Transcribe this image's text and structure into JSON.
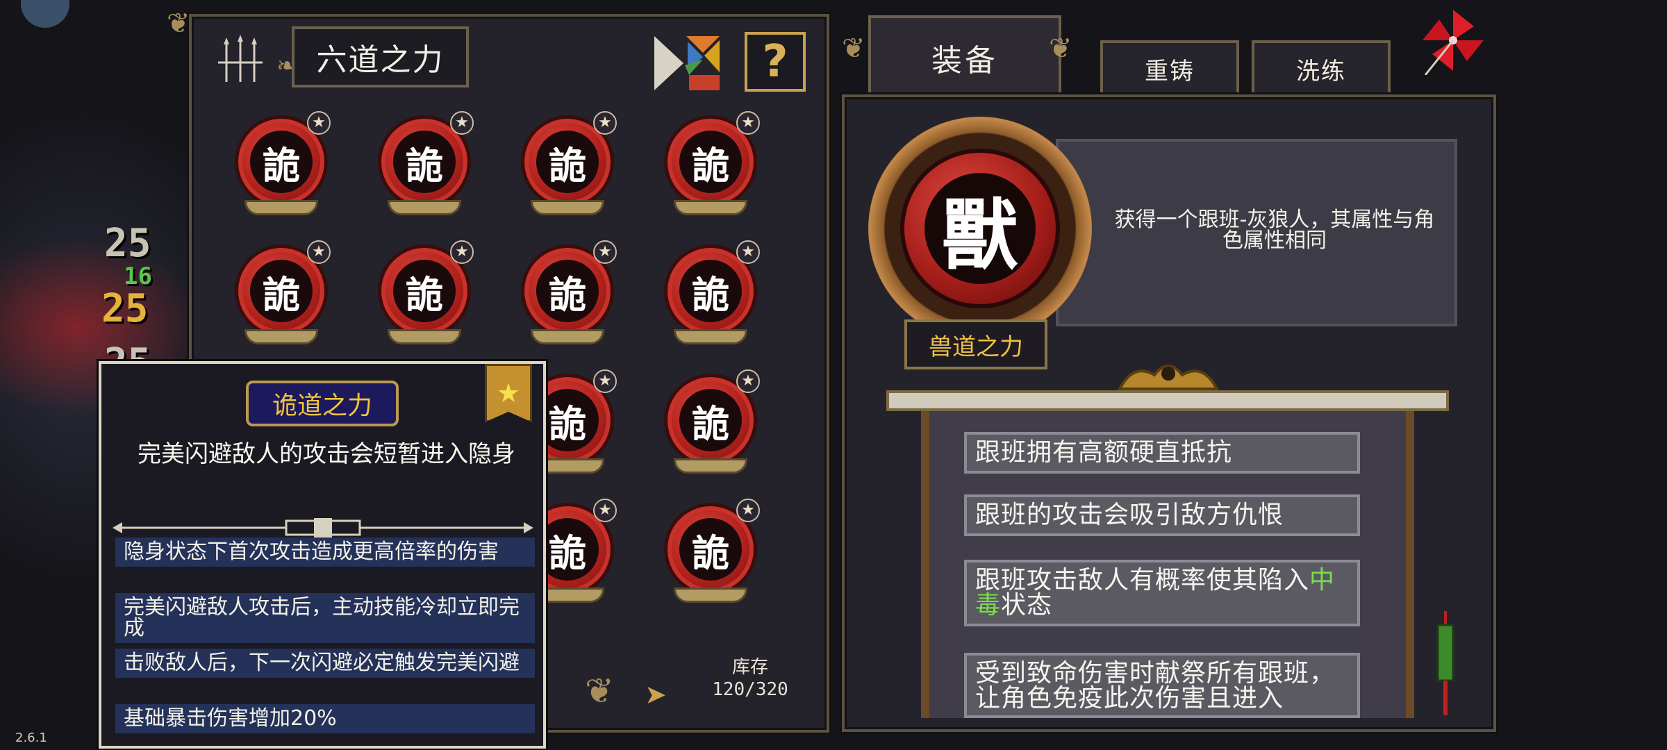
{
  "version": "2.6.1",
  "background_numbers": [
    "25",
    "16",
    "25",
    "25"
  ],
  "left_panel": {
    "title": "六道之力",
    "help_label": "?",
    "orb_glyph": "詭",
    "orb_star": "★",
    "stock_label": "库存",
    "stock_value": "120/320",
    "next_arrow": "➤"
  },
  "tooltip": {
    "title": "诡道之力",
    "badge": "★",
    "headline": "完美闪避敌人的攻击会短暂进入隐身",
    "items": [
      "隐身状态下首次攻击造成更高倍率的伤害",
      "完美闪避敌人攻击后，主动技能冷却立即完成",
      "击败敌人后，下一次闪避必定触发完美闪避",
      "基础暴击伤害增加20%"
    ]
  },
  "tabs": {
    "equip": "装备",
    "recast": "重铸",
    "refine": "洗练"
  },
  "detail": {
    "glyph": "獸",
    "description": "获得一个跟班-灰狼人，其属性与角色属性相同",
    "power_name": "兽道之力",
    "traits": [
      {
        "text": "跟班拥有高额硬直抵抗"
      },
      {
        "text": "跟班的攻击会吸引敌方仇恨"
      },
      {
        "pre": "跟班攻击敌人有概率使其陷入",
        "highlight": "中毒",
        "post": "状态"
      },
      {
        "text": "受到致命伤害时献祭所有跟班，让角色免疫此次伤害且进入"
      }
    ]
  },
  "colors": {
    "gold": "#f1c045",
    "poison_green": "#78e04a",
    "orb_red": "#b0211c",
    "tooltip_title_bg": "#1c1a5c"
  },
  "icons": [
    "banner-icon",
    "tangram-icon",
    "help-icon",
    "star-icon",
    "pinwheel-icon",
    "arrow-right-icon"
  ]
}
